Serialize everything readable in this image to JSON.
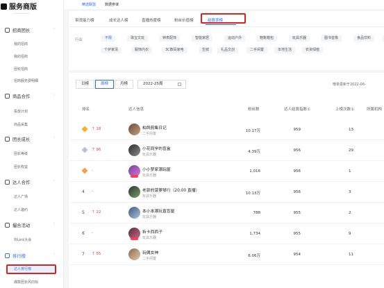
{
  "app": {
    "title": "服务商版",
    "subtitle": "——————"
  },
  "topnav": [
    {
      "label": "精选联盟",
      "active": true
    },
    {
      "label": "数据参谋",
      "active": false
    }
  ],
  "sidebar": {
    "groups": [
      {
        "label": "招商团长",
        "items": [
          "我的招商",
          "我的招商",
          "团长招商",
          "招商服务费明细"
        ]
      },
      {
        "label": "商品合作",
        "items": [
          "投放计划",
          "商品采集"
        ]
      },
      {
        "label": "团长成长",
        "items": [
          "团长等级",
          "团长权益"
        ]
      },
      {
        "label": "达人合作",
        "items": [
          "达人广场",
          "达人邀约"
        ]
      },
      {
        "label": "撮合活动",
        "items": [
          "抖Link大会"
        ]
      },
      {
        "label": "排行榜",
        "items": [
          "达人排行榜",
          "爆款团长风向标"
        ]
      }
    ]
  },
  "ranking_tabs": [
    {
      "label": "带货能力榜",
      "active": false
    },
    {
      "label": "成长达人榜",
      "active": false
    },
    {
      "label": "直播热度榜",
      "active": false
    },
    {
      "label": "粉丝价值榜",
      "active": false
    },
    {
      "label": "结算率榜",
      "active": true
    }
  ],
  "filters": {
    "label": "行业",
    "chips": [
      {
        "label": "不限",
        "active": true
      },
      {
        "label": "珠宝文玩",
        "active": false
      },
      {
        "label": "钟表配饰",
        "active": false
      },
      {
        "label": "智能家居",
        "active": false
      },
      {
        "label": "运动户外",
        "active": false
      },
      {
        "label": "鞋靴箱包",
        "active": false
      },
      {
        "label": "玩具乐器",
        "active": false
      },
      {
        "label": "图书音像",
        "active": false
      },
      {
        "label": "食品饮料",
        "active": false
      },
      {
        "label": "母婴",
        "active": false
      },
      {
        "label": "个护家清",
        "active": false
      },
      {
        "label": "服饰内衣",
        "active": false
      },
      {
        "label": "3C数码家电",
        "active": false
      },
      {
        "label": "生鲜",
        "active": false
      },
      {
        "label": "礼品文创",
        "active": false
      },
      {
        "label": "二手闲置",
        "active": false
      },
      {
        "label": "本地生活",
        "active": false
      },
      {
        "label": "农资绿植",
        "active": false
      }
    ]
  },
  "period_tabs": [
    {
      "label": "日榜",
      "active": false
    },
    {
      "label": "周榜",
      "active": true
    },
    {
      "label": "月榜",
      "active": false
    }
  ],
  "date_value": "2022-25周",
  "updated_label": "榜单更新于2022-06-",
  "columns": {
    "rank": "排名",
    "info": "达人信息",
    "fans": "粉丝数",
    "index": "达人结算指数①",
    "ups": "上榜次数①",
    "org": "所属机构"
  },
  "rows": [
    {
      "medal": "gold",
      "change": "↑ 18",
      "name": "柏鸽剪集日记",
      "category": "二手闲置",
      "fans": "10.17万",
      "index": "959",
      "ups": "13"
    },
    {
      "medal": "silver",
      "change": "↑ 96",
      "name": "小花同学的盲盒",
      "category": "玩具乐器",
      "fans": "4.39万",
      "index": "956",
      "ups": "29"
    },
    {
      "medal": "bronze",
      "change": "-",
      "name": "小小梦家潮玩屋",
      "category": "玩具乐器",
      "fans": "1,016",
      "index": "956",
      "ups": "1"
    },
    {
      "rank": "4",
      "change": "-",
      "name": "老郭的菠萝琴行（20:00 直播）",
      "category": "玩具乐器",
      "fans": "10.13万",
      "index": "956",
      "ups": "3"
    },
    {
      "rank": "5",
      "change": "↑ 22",
      "name": "本小本潮玩直盲屋",
      "category": "玩具乐器",
      "fans": "788",
      "index": "955",
      "ups": "2"
    },
    {
      "rank": "6",
      "change": "-",
      "name": "拆卡西西子",
      "category": "玩具乐器",
      "fans": "1,734",
      "index": "955",
      "ups": "9"
    },
    {
      "rank": "7",
      "change": "↑ 55",
      "name": "玩偶女神",
      "category": "二手闲置",
      "fans": "6.06万",
      "index": "954",
      "ups": "11"
    }
  ],
  "colors": {
    "accent": "#2a6ff2",
    "highlight_box": "#e02020",
    "up": "#e63946",
    "gold": "#f5b324",
    "silver": "#b9c3d6",
    "bronze": "#f0a24a"
  }
}
